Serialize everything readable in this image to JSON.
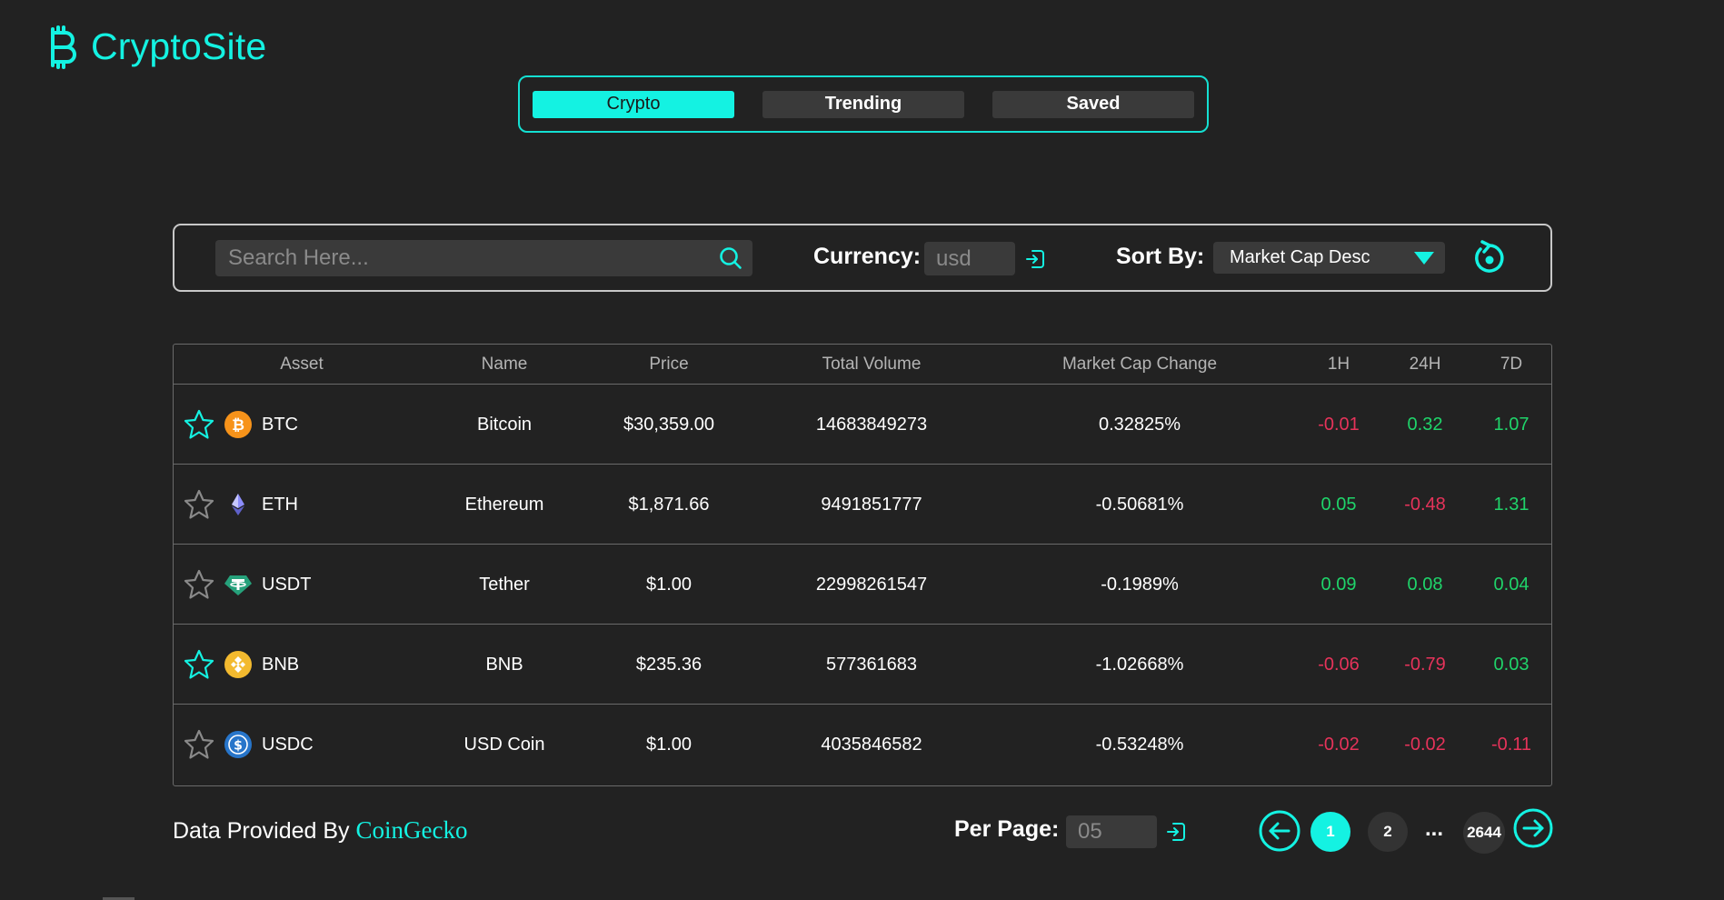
{
  "app": {
    "name": "CryptoSite"
  },
  "tabs": [
    {
      "label": "Crypto",
      "active": true
    },
    {
      "label": "Trending",
      "active": false
    },
    {
      "label": "Saved",
      "active": false
    }
  ],
  "filters": {
    "search_placeholder": "Search Here...",
    "currency_label": "Currency:",
    "currency_placeholder": "usd",
    "sort_label": "Sort By:",
    "sort_value": "Market Cap Desc"
  },
  "table": {
    "headers": [
      "Asset",
      "Name",
      "Price",
      "Total Volume",
      "Market Cap Change",
      "1H",
      "24H",
      "7D"
    ],
    "rows": [
      {
        "symbol": "BTC",
        "name": "Bitcoin",
        "price": "$30,359.00",
        "volume": "14683849273",
        "mcap_change": "0.32825%",
        "h1": "-0.01",
        "h24": "0.32",
        "d7": "1.07",
        "saved": true,
        "icon": "bitcoin-icon"
      },
      {
        "symbol": "ETH",
        "name": "Ethereum",
        "price": "$1,871.66",
        "volume": "9491851777",
        "mcap_change": "-0.50681%",
        "h1": "0.05",
        "h24": "-0.48",
        "d7": "1.31",
        "saved": false,
        "icon": "ethereum-icon"
      },
      {
        "symbol": "USDT",
        "name": "Tether",
        "price": "$1.00",
        "volume": "22998261547",
        "mcap_change": "-0.1989%",
        "h1": "0.09",
        "h24": "0.08",
        "d7": "0.04",
        "saved": false,
        "icon": "tether-icon"
      },
      {
        "symbol": "BNB",
        "name": "BNB",
        "price": "$235.36",
        "volume": "577361683",
        "mcap_change": "-1.02668%",
        "h1": "-0.06",
        "h24": "-0.79",
        "d7": "0.03",
        "saved": true,
        "icon": "bnb-icon"
      },
      {
        "symbol": "USDC",
        "name": "USD Coin",
        "price": "$1.00",
        "volume": "4035846582",
        "mcap_change": "-0.53248%",
        "h1": "-0.02",
        "h24": "-0.02",
        "d7": "-0.11",
        "saved": false,
        "icon": "usdc-icon"
      }
    ]
  },
  "footer": {
    "credit_prefix": "Data Provided By",
    "credit_source": "CoinGecko",
    "perpage_label": "Per Page:",
    "perpage_placeholder": "05",
    "pages": [
      "1",
      "2"
    ],
    "ellipsis": "...",
    "last_page": "2644",
    "current_page": "1"
  },
  "colors": {
    "accent": "#14f2e2",
    "positive": "#1fd46a",
    "negative": "#e6335a",
    "background": "#222222"
  }
}
